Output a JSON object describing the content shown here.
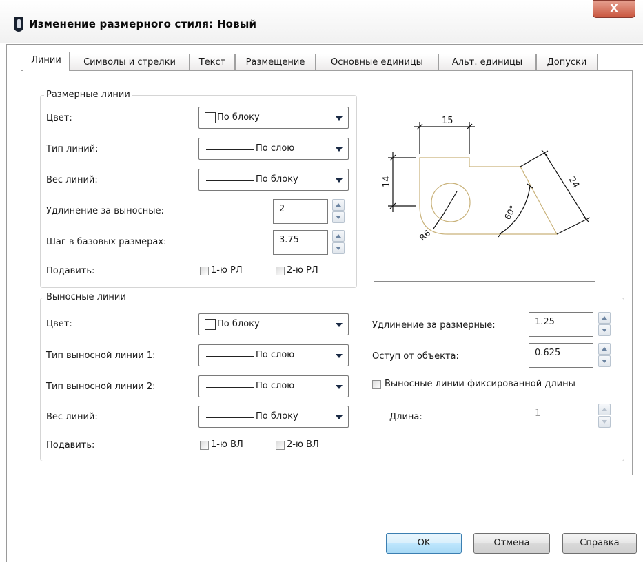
{
  "window": {
    "title": "Изменение размерного стиля: Новый",
    "close_glyph": "X"
  },
  "tabs": [
    "Линии",
    "Символы и стрелки",
    "Текст",
    "Размещение",
    "Основные единицы",
    "Альт. единицы",
    "Допуски"
  ],
  "active_tab": "Линии",
  "dim_lines": {
    "group_label": "Размерные линии",
    "color_label": "Цвет:",
    "color_value": "По блоку",
    "linetype_label": "Тип линий:",
    "linetype_value": "По слою",
    "lineweight_label": "Вес линий:",
    "lineweight_value": "По блоку",
    "extend_label": "Удлинение за выносные:",
    "extend_value": "2",
    "baseline_label": "Шаг в базовых размерах:",
    "baseline_value": "3.75",
    "suppress_label": "Подавить:",
    "suppress_1": "1-ю РЛ",
    "suppress_2": "2-ю РЛ"
  },
  "ext_lines": {
    "group_label": "Выносные линии",
    "color_label": "Цвет:",
    "color_value": "По блоку",
    "type1_label": "Тип выносной линии 1:",
    "type1_value": "По слою",
    "type2_label": "Тип выносной линии 2:",
    "type2_value": "По слою",
    "lineweight_label": "Вес линий:",
    "lineweight_value": "По блоку",
    "suppress_label": "Подавить:",
    "suppress_1": "1-ю ВЛ",
    "suppress_2": "2-ю ВЛ",
    "extend_label": "Удлинение за размерные:",
    "extend_value": "1.25",
    "offset_label": "Оступ от объекта:",
    "offset_value": "0.625",
    "fixed_label": "Выносные линии фиксированной длины",
    "length_label": "Длина:",
    "length_value": "1"
  },
  "preview": {
    "dim_top": "15",
    "dim_left": "14",
    "dim_right": "24",
    "dim_angle": "60°",
    "dim_radius": "R6"
  },
  "buttons": {
    "ok": "OK",
    "cancel": "Отмена",
    "help": "Справка"
  },
  "colors": {
    "close_button": "#c9563f",
    "preview_geometry": "#c9b27a",
    "default_button": "#3c7fb1"
  }
}
